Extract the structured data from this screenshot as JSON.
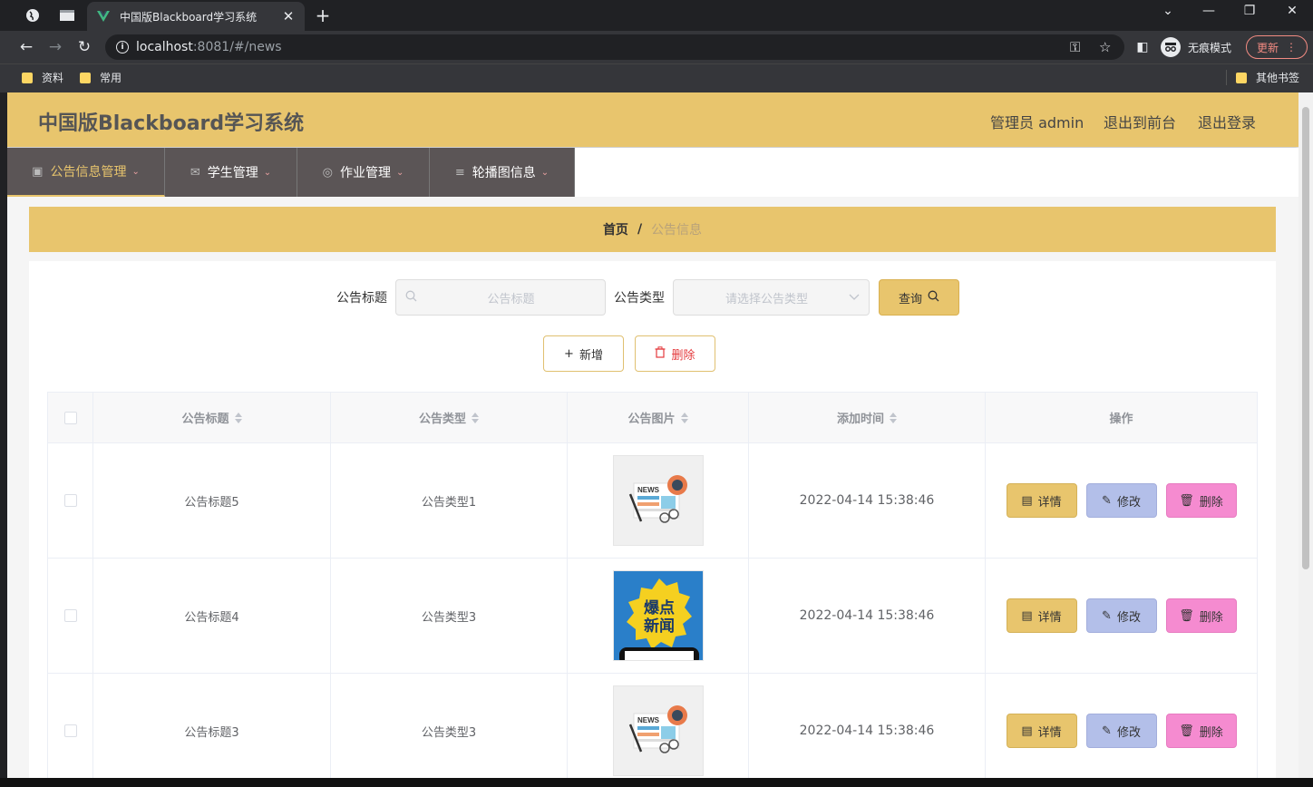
{
  "browser": {
    "tab_title": "中国版Blackboard学习系统",
    "url_host": "localhost",
    "url_rest": ":8081/#/news",
    "incognito_label": "无痕模式",
    "update_label": "更新",
    "bookmarks": [
      "资料",
      "常用"
    ],
    "other_bookmarks": "其他书签"
  },
  "header": {
    "site_title": "中国版Blackboard学习系统",
    "admin_label": "管理员 admin",
    "to_front_label": "退出到前台",
    "logout_label": "退出登录"
  },
  "menu": [
    {
      "label": "公告信息管理",
      "icon": "clipboard-icon"
    },
    {
      "label": "学生管理",
      "icon": "mail-icon"
    },
    {
      "label": "作业管理",
      "icon": "compass-icon"
    },
    {
      "label": "轮播图信息",
      "icon": "list-icon"
    }
  ],
  "breadcrumb": {
    "home": "首页",
    "separator": "/",
    "current": "公告信息"
  },
  "search": {
    "title_label": "公告标题",
    "title_placeholder": "公告标题",
    "type_label": "公告类型",
    "type_placeholder": "请选择公告类型",
    "query_label": "查询"
  },
  "actions": {
    "add_label": "新增",
    "delete_label": "删除"
  },
  "table": {
    "columns": [
      "公告标题",
      "公告类型",
      "公告图片",
      "添加时间",
      "操作"
    ],
    "rows": [
      {
        "title": "公告标题5",
        "type": "公告类型1",
        "image": "news-paper",
        "time": "2022-04-14 15:38:46"
      },
      {
        "title": "公告标题4",
        "type": "公告类型3",
        "image": "breaking-news",
        "time": "2022-04-14 15:38:46"
      },
      {
        "title": "公告标题3",
        "type": "公告类型3",
        "image": "news-paper",
        "time": "2022-04-14 15:38:46"
      }
    ],
    "op_labels": {
      "detail": "详情",
      "edit": "修改",
      "delete": "删除"
    }
  },
  "thumb_text": {
    "news": "NEWS",
    "breaking_line1": "爆点",
    "breaking_line2": "新闻"
  },
  "colors": {
    "accent": "#e8c56d",
    "menu_bg": "#5b5556",
    "edit": "#b3bfe9",
    "delete": "#f58bd0"
  }
}
